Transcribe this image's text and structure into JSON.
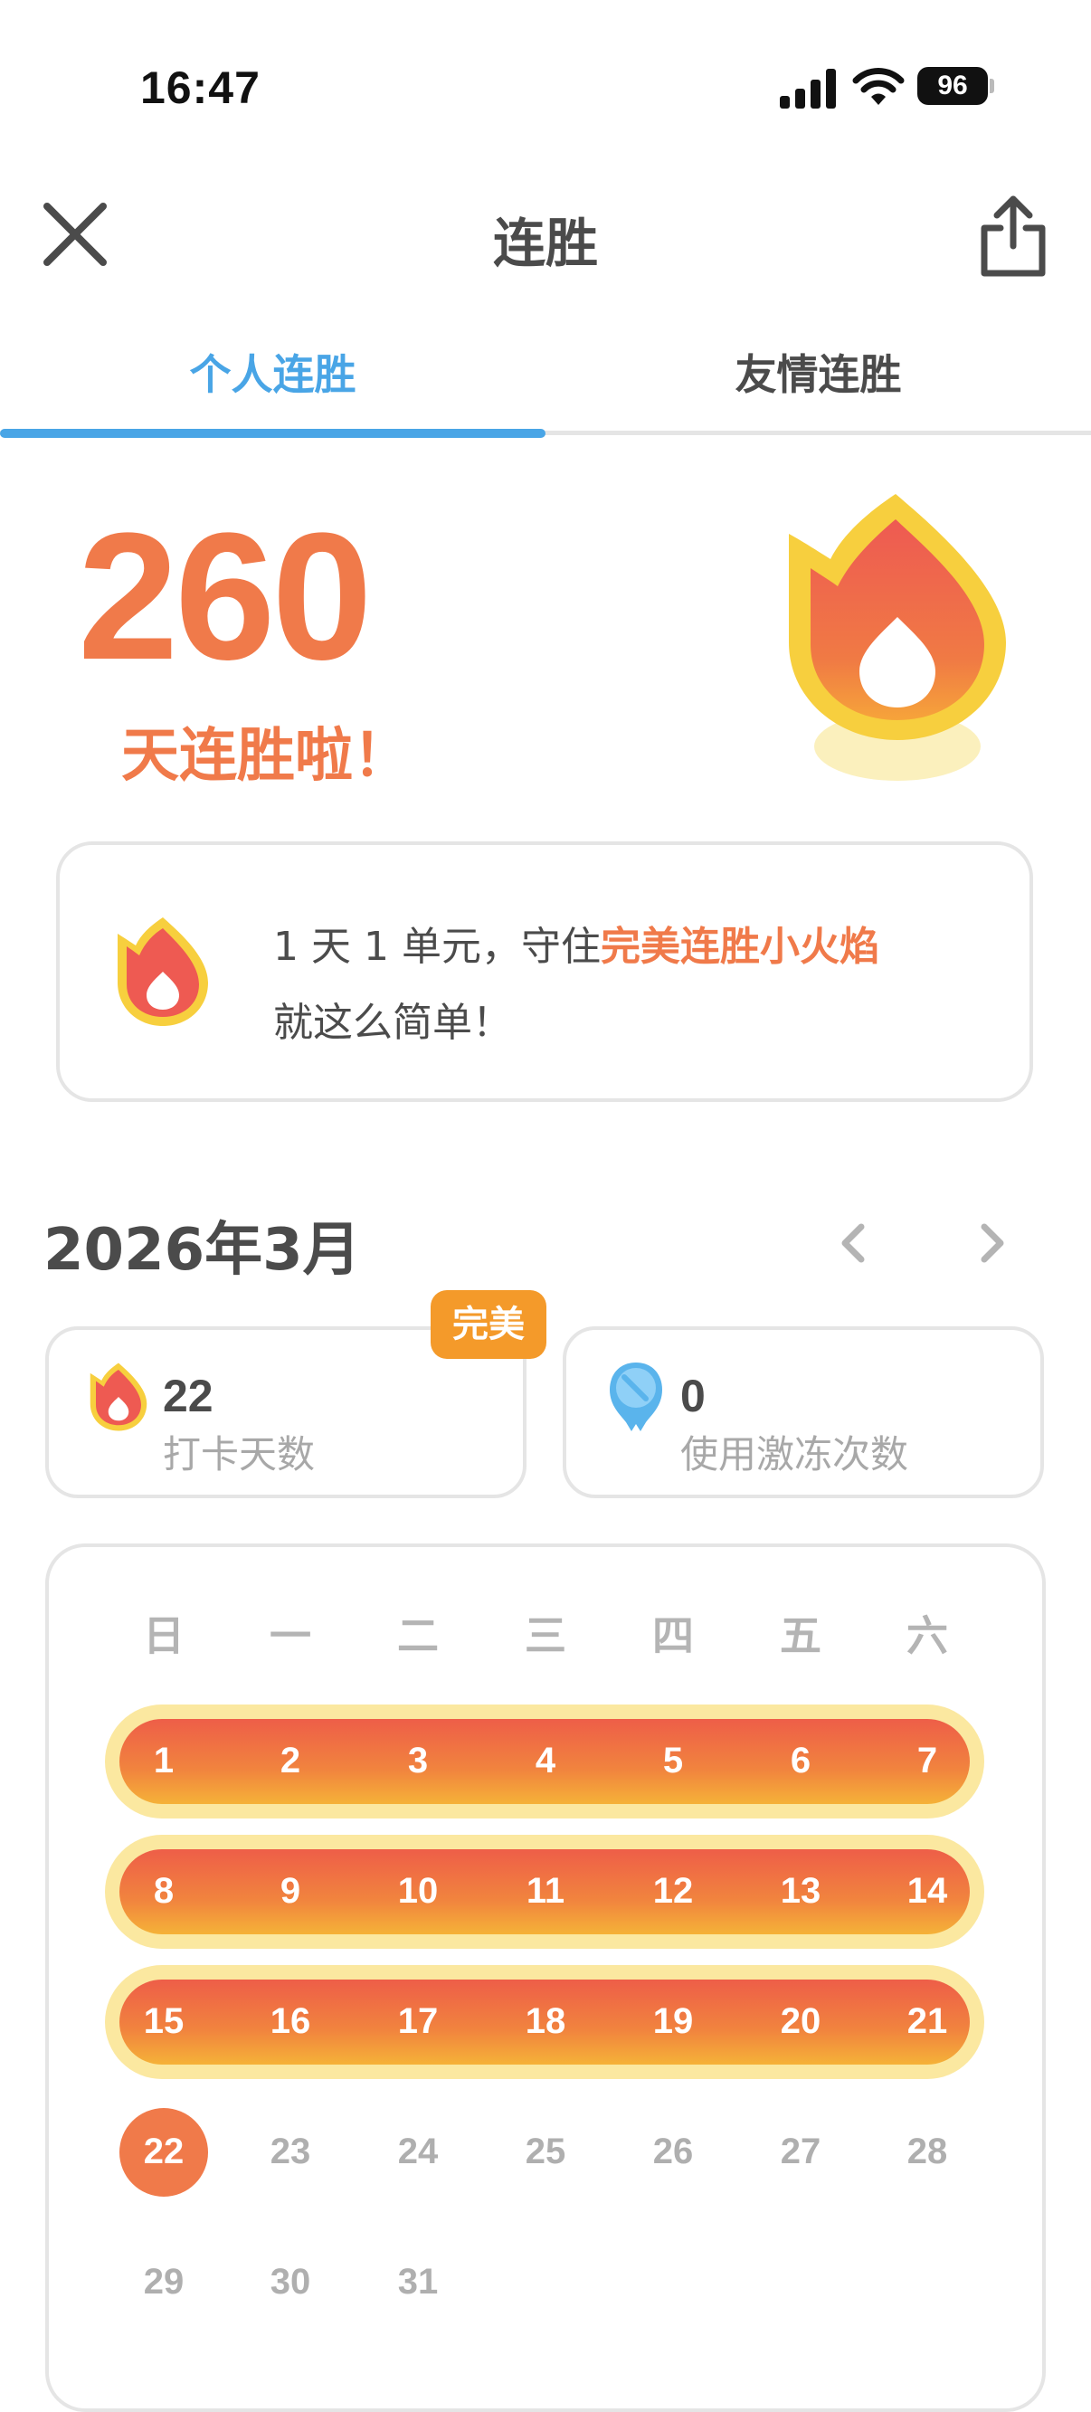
{
  "status_bar": {
    "time": "16:47",
    "battery": "96"
  },
  "header": {
    "title": "连胜"
  },
  "tabs": [
    {
      "label": "个人连胜",
      "active": true
    },
    {
      "label": "友情连胜",
      "active": false
    }
  ],
  "streak": {
    "count": "260",
    "label": "天连胜啦！"
  },
  "info": {
    "line1_prefix": "1 天 1 单元，守住",
    "line1_highlight": "完美连胜小火焰",
    "line2": "就这么简单！"
  },
  "calendar": {
    "month_label": "2026年3月",
    "badge": "完美",
    "stats": {
      "checkin_count": "22",
      "checkin_label": "打卡天数",
      "freeze_count": "0",
      "freeze_label": "使用激冻次数"
    },
    "weekdays": [
      "日",
      "一",
      "二",
      "三",
      "四",
      "五",
      "六"
    ],
    "weeks": [
      [
        "1",
        "2",
        "3",
        "4",
        "5",
        "6",
        "7"
      ],
      [
        "8",
        "9",
        "10",
        "11",
        "12",
        "13",
        "14"
      ],
      [
        "15",
        "16",
        "17",
        "18",
        "19",
        "20",
        "21"
      ],
      [
        "22",
        "23",
        "24",
        "25",
        "26",
        "27",
        "28"
      ],
      [
        "29",
        "30",
        "31"
      ]
    ],
    "today": "22"
  },
  "colors": {
    "accent_blue": "#49a5e6",
    "streak_orange": "#f07a4a",
    "badge_orange": "#f49a2a"
  }
}
